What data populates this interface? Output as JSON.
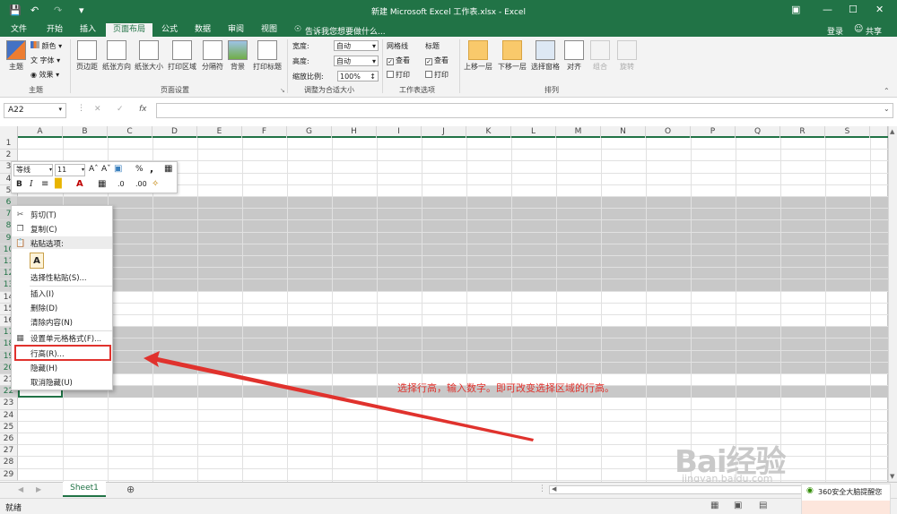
{
  "window": {
    "title": "新建 Microsoft Excel 工作表.xlsx - Excel"
  },
  "tabs": [
    {
      "label": "文件"
    },
    {
      "label": "开始"
    },
    {
      "label": "插入"
    },
    {
      "label": "页面布局"
    },
    {
      "label": "公式"
    },
    {
      "label": "数据"
    },
    {
      "label": "审阅"
    },
    {
      "label": "视图"
    }
  ],
  "tell_me": "告诉我您想要做什么...",
  "login": "登录",
  "share": "共享",
  "ribbon": {
    "theme_group": {
      "label": "主题",
      "theme_btn": "主题",
      "colors": "颜色",
      "fonts": "字体",
      "effects": "效果"
    },
    "page_setup": {
      "label": "页面设置",
      "buttons": [
        "页边距",
        "纸张方向",
        "纸张大小",
        "打印区域",
        "分隔符",
        "背景",
        "打印标题"
      ]
    },
    "scale": {
      "label": "调整为合适大小",
      "width_label": "宽度:",
      "width_value": "自动",
      "height_label": "高度:",
      "height_value": "自动",
      "zoom_label": "缩放比例:",
      "zoom_value": "100%"
    },
    "sheet_options": {
      "label": "工作表选项",
      "gridlines": "网格线",
      "headings": "标题",
      "view": "查看",
      "print": "打印"
    },
    "arrange": {
      "label": "排列",
      "buttons": [
        "上移一层",
        "下移一层",
        "选择窗格",
        "对齐",
        "组合",
        "旋转"
      ]
    }
  },
  "formula_bar": {
    "name_box": "A22",
    "fx": "fx"
  },
  "columns": [
    "A",
    "B",
    "C",
    "D",
    "E",
    "F",
    "G",
    "H",
    "I",
    "J",
    "K",
    "L",
    "M",
    "N",
    "O",
    "P",
    "Q",
    "R",
    "S"
  ],
  "rows": [
    "1",
    "2",
    "3",
    "4",
    "5",
    "6",
    "7",
    "8",
    "9",
    "10",
    "11",
    "12",
    "13",
    "14",
    "15",
    "16",
    "17",
    "18",
    "19",
    "20",
    "21",
    "22",
    "23",
    "24",
    "25",
    "26",
    "27",
    "28",
    "29"
  ],
  "mini_toolbar": {
    "font": "等线",
    "size": "11"
  },
  "context_menu": {
    "items": [
      "剪切(T)",
      "复制(C)",
      "粘贴选项:",
      "选择性粘贴(S)...",
      "插入(I)",
      "删除(D)",
      "清除内容(N)",
      "设置单元格格式(F)...",
      "行高(R)...",
      "隐藏(H)",
      "取消隐藏(U)"
    ]
  },
  "annotation": "选择行高，输入数字。即可改变选择区域的行高。",
  "sheet_tab": "Sheet1",
  "status": "就绪",
  "notification": "360安全大脑提醒您",
  "watermark": "Bai经验",
  "watermark_url": "jingyan.baidu.com",
  "colors": {
    "excel_green": "#217346",
    "highlight_red": "#e0322d"
  }
}
